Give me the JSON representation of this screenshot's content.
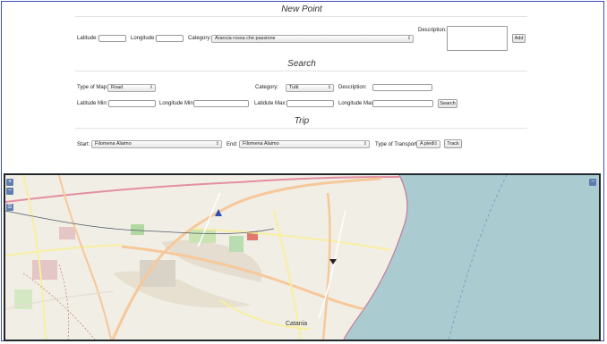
{
  "new_point": {
    "title": "New Point",
    "latitude_label": "Latitude:",
    "longitude_label": "Longitude:",
    "category_label": "Category:",
    "category_value": "Arancia rossa che passione",
    "description_label": "Description:",
    "add_label": "Add"
  },
  "search": {
    "title": "Search",
    "type_of_map_label": "Type of Map:",
    "type_of_map_value": "Road",
    "category_label": "Category:",
    "category_value": "Tutti",
    "description_label": "Description:",
    "latitude_min_label": "Latitude Min:",
    "longitude_min_label": "Longitude Min:",
    "latitude_max_label": "Latidute Max:",
    "longitude_max_label": "Longitude Max:",
    "search_label": "Search"
  },
  "trip": {
    "title": "Trip",
    "start_label": "Start:",
    "start_value": "Filomena Alaimo",
    "end_label": "End:",
    "end_value": "Filomena Alaimo",
    "transport_label": "Type of Transport:",
    "transport_value": "A piedi",
    "track_label": "Track"
  },
  "map": {
    "zoom_in": "+",
    "zoom_out": "−",
    "layers_toggle": "−",
    "city_label": "Catania",
    "sea_color": "#aacbd0",
    "land_color": "#f1eee6",
    "park_color": "#c9e3b3",
    "primary_road_color": "#f6c89a",
    "secondary_road_color": "#f8efa0",
    "motorway_color": "#e38fa0"
  }
}
